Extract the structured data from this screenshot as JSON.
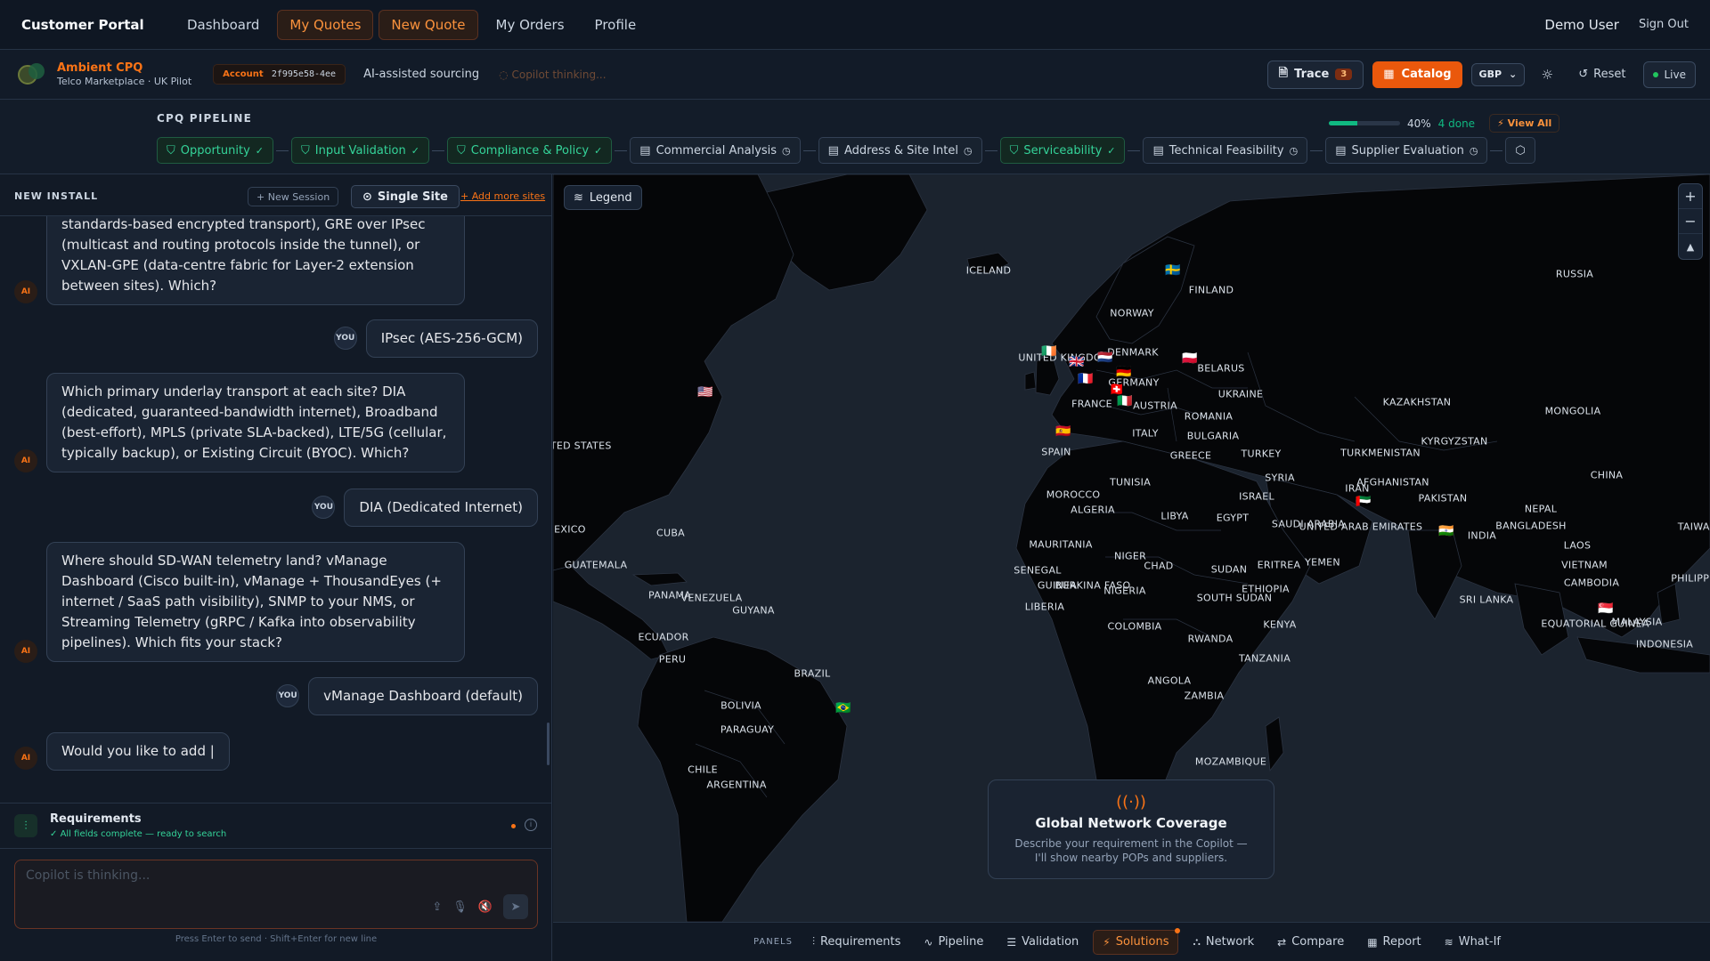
{
  "nav": {
    "brand": "Customer Portal",
    "links": [
      "Dashboard",
      "My Quotes",
      "New Quote",
      "My Orders",
      "Profile"
    ],
    "user": "Demo User",
    "signout": "Sign Out"
  },
  "subheader": {
    "app_name": "Ambient CPQ",
    "app_sub": "Telco Marketplace · UK Pilot",
    "account_label": "Account",
    "account_id": "2f995e58-4ee",
    "sourcing": "AI-assisted sourcing",
    "thinking": "Copilot thinking...",
    "trace_label": "Trace",
    "trace_count": "3",
    "catalog_label": "Catalog",
    "currency": "GBP",
    "reset_label": "Reset",
    "live_label": "Live"
  },
  "pipeline": {
    "title": "CPQ PIPELINE",
    "progress_fraction": 0.4,
    "progress_pct": "40%",
    "done_text": "4 done",
    "view_all": "View All",
    "stages": [
      {
        "label": "Opportunity",
        "done": true
      },
      {
        "label": "Input Validation",
        "done": true
      },
      {
        "label": "Compliance & Policy",
        "done": true
      },
      {
        "label": "Commercial Analysis",
        "done": false
      },
      {
        "label": "Address & Site Intel",
        "done": false
      },
      {
        "label": "Serviceability",
        "done": true
      },
      {
        "label": "Technical Feasibility",
        "done": false
      },
      {
        "label": "Supplier Evaluation",
        "done": false
      }
    ]
  },
  "left": {
    "title": "NEW INSTALL",
    "new_session": "+ New Session",
    "single_site": "Single Site",
    "add_more": "+ Add more sites",
    "messages": [
      {
        "role": "ai",
        "text": "standards-based encrypted transport), GRE over IPsec (multicast and routing protocols inside the tunnel), or VXLAN-GPE (data-centre fabric for Layer-2 extension between sites). Which?"
      },
      {
        "role": "you",
        "text": "IPsec (AES-256-GCM)"
      },
      {
        "role": "ai",
        "text": "Which primary underlay transport at each site? DIA (dedicated, guaranteed-bandwidth internet), Broadband (best-effort), MPLS (private SLA-backed), LTE/5G (cellular, typically backup), or Existing Circuit (BYOC). Which?"
      },
      {
        "role": "you",
        "text": "DIA (Dedicated Internet)"
      },
      {
        "role": "ai",
        "text": "Where should SD-WAN telemetry land? vManage Dashboard (Cisco built-in), vManage + ThousandEyes (+ internet / SaaS path visibility), SNMP to your NMS, or Streaming Telemetry (gRPC / Kafka into observability pipelines). Which fits your stack?"
      },
      {
        "role": "you",
        "text": "vManage Dashboard (default)"
      },
      {
        "role": "ai",
        "text": "Would you like to add |"
      }
    ],
    "ai_avatar": "AI",
    "you_avatar": "YOU",
    "requirements_title": "Requirements",
    "requirements_status": "All fields complete — ready to search",
    "composer_placeholder": "Copilot is thinking...",
    "hint": "Press Enter to send · Shift+Enter for new line"
  },
  "map": {
    "legend_label": "Legend",
    "coverage_title": "Global Network Coverage",
    "coverage_text": "Describe your requirement in the Copilot — I'll show nearby POPs and suppliers.",
    "labels": [
      "Iceland",
      "Finland",
      "Norway",
      "Russia",
      "United Kingdom",
      "Denmark",
      "Belarus",
      "Germany",
      "Ukraine",
      "France",
      "Austria",
      "Kazakhstan",
      "Mongolia",
      "Romania",
      "Italy",
      "Bulgaria",
      "Kyrgyzstan",
      "United States",
      "Spain",
      "Greece",
      "Turkey",
      "Turkmenistan",
      "China",
      "Tunisia",
      "Syria",
      "Afghanistan",
      "Morocco",
      "Iran",
      "Israel",
      "Pakistan",
      "Algeria",
      "Libya",
      "Egypt",
      "Saudi Arabia",
      "United Arab Emirates",
      "Nepal",
      "Bangladesh",
      "Taiwan",
      "Mexico",
      "Cuba",
      "India",
      "Mauritania",
      "Niger",
      "Laos",
      "Guatemala",
      "Senegal",
      "Burkina Faso",
      "Chad",
      "Sudan",
      "Eritrea",
      "Yemen",
      "Vietnam",
      "Guinea",
      "Cambodia",
      "Philippines",
      "Panama",
      "Venezuela",
      "Nigeria",
      "Ethiopia",
      "South Sudan",
      "Sri Lanka",
      "Guyana",
      "Liberia",
      "Colombia",
      "Equatorial Guinea",
      "Kenya",
      "Malaysia",
      "Ecuador",
      "Rwanda",
      "Indonesia",
      "Peru",
      "Tanzania",
      "Brazil",
      "Angola",
      "Bolivia",
      "Zambia",
      "Paraguay",
      "Chile",
      "Argentina",
      "Mozambique"
    ],
    "flags": [
      "🇺🇸",
      "🇮🇪",
      "🇬🇧",
      "🇳🇱",
      "🇩🇪",
      "🇫🇷",
      "🇨🇭",
      "🇮🇹",
      "🇪🇸",
      "🇸🇪",
      "🇵🇱",
      "🇦🇪",
      "🇮🇳",
      "🇸🇬",
      "🇧🇷"
    ]
  },
  "panels": {
    "title": "PANELS",
    "tabs": [
      {
        "label": "Requirements",
        "icon": "sliders-icon"
      },
      {
        "label": "Pipeline",
        "icon": "activity-icon"
      },
      {
        "label": "Validation",
        "icon": "checklist-icon"
      },
      {
        "label": "Solutions",
        "icon": "bolt-icon",
        "active": true
      },
      {
        "label": "Network",
        "icon": "network-icon"
      },
      {
        "label": "Compare",
        "icon": "compare-icon"
      },
      {
        "label": "Report",
        "icon": "grid-icon"
      },
      {
        "label": "What-If",
        "icon": "layers-icon"
      }
    ]
  },
  "colors": {
    "accent": "#f97316",
    "success": "#10b981",
    "background": "#121a26"
  }
}
